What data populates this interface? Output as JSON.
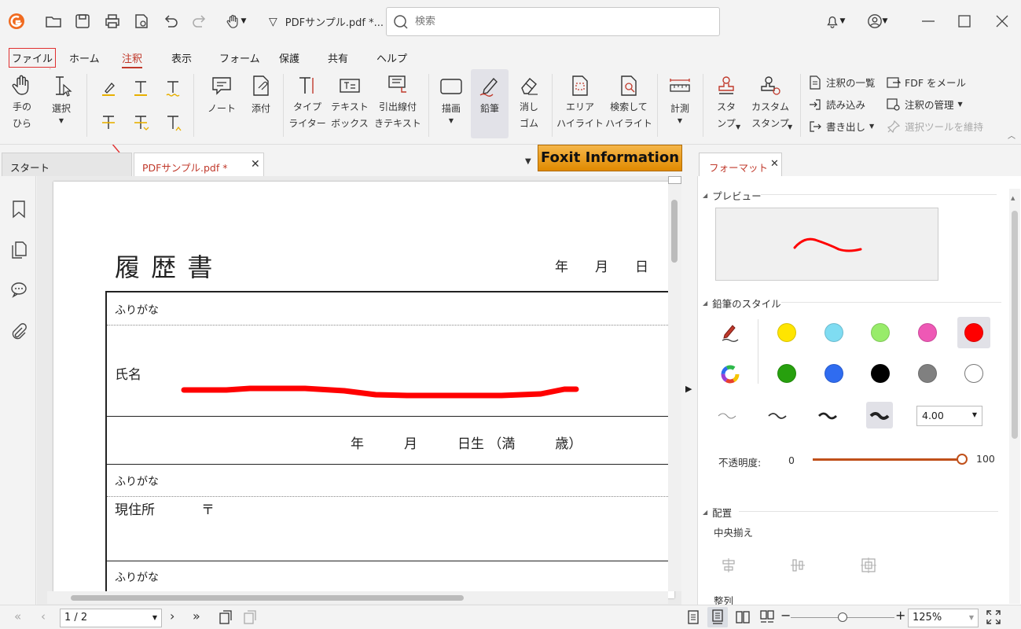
{
  "titlebar": {
    "doc_name": "PDFサンプル.pdf *...",
    "search_placeholder": "検索"
  },
  "menu": {
    "tabs": [
      "ファイル",
      "ホーム",
      "注釈",
      "表示",
      "フォーム",
      "保護",
      "共有",
      "ヘルプ"
    ],
    "active": "注釈",
    "highlighted": "ファイル"
  },
  "ribbon": {
    "hand": "手の\nひら",
    "select": "選択",
    "note": "ノート",
    "attach": "添付",
    "typewriter": "タイプ\nライター",
    "textbox": "テキスト\nボックス",
    "callout": "引出線付\nきテキスト",
    "drawing": "描画",
    "pencil": "鉛筆",
    "eraser": "消し\nゴム",
    "area_highlight": "エリア\nハイライト",
    "search_highlight": "検索して\nハイライト",
    "measure": "計測",
    "stamp": "スタ\nンプ",
    "custom_stamp": "カスタム\nスタンプ",
    "list": {
      "annot_list": "注釈の一覧",
      "import": "読み込み",
      "export": "書き出し",
      "fdf_mail": "FDF をメール",
      "annot_manage": "注釈の管理",
      "keep_tool": "選択ツールを維持"
    }
  },
  "tabs": {
    "start": "スタート",
    "doc": "PDFサンプル.pdf *",
    "banner": "Foxit Information"
  },
  "pdf": {
    "title": "履 歴 書",
    "date_line": "年　　月　　日",
    "furigana": "ふりがな",
    "name_label": "氏名",
    "birth_line": "年　　　月　　　日生 （満　　　歳）",
    "address_label": "現住所",
    "postal_mark": "〒"
  },
  "format_panel": {
    "tab_label": "フォーマット",
    "preview_title": "プレビュー",
    "style_title": "鉛筆のスタイル",
    "colors": [
      "#ffe500",
      "#7fdcf2",
      "#98ec6a",
      "#ee58b5",
      "#ff0000",
      "#27a00e",
      "#2f6cf0",
      "#000000",
      "#808080",
      "#ffffff"
    ],
    "selected_color": "#ff0000",
    "line_width_value": "4.00",
    "opacity_label": "不透明度:",
    "opacity_min": "0",
    "opacity_max": "100",
    "opacity_value": 100,
    "placement_title": "配置",
    "center_align": "中央揃え",
    "align_title": "整列"
  },
  "status": {
    "page": "1 / 2",
    "zoom": "125%",
    "zoom_level": 0.5
  },
  "accent_color": "#c0392b"
}
